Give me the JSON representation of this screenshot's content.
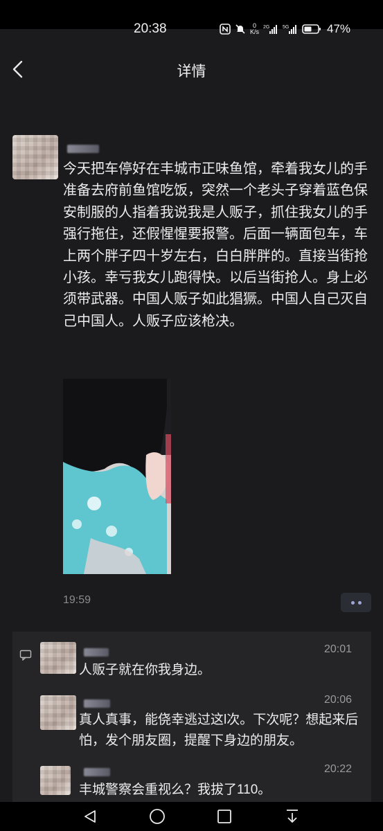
{
  "status_bar": {
    "time": "20:38",
    "network_speed": "0\nK/s",
    "signal_1_label": "2G",
    "signal_2_label": "5G",
    "battery_percent": "47%"
  },
  "header": {
    "title": "详情"
  },
  "post": {
    "text": "今天把车停好在丰城市正味鱼馆，牵着我女儿的手准备去府前鱼馆吃饭，突然一个老头子穿着蓝色保安制服的人指着我说我是人贩子，抓住我女儿的手强行拖住，还假惺惺要报警。后面一辆面包车，车上两个胖子四十岁左右，白白胖胖的。直接当街抢小孩。幸亏我女儿跑得快。以后当街抢人。身上必须带武器。中国人贩子如此猖獗。中国人自己灭自己中国人。人贩子应该枪决。",
    "time": "19:59"
  },
  "comments": [
    {
      "time": "20:01",
      "text": "人贩子就在你我身边。"
    },
    {
      "time": "20:06",
      "text": "真人真事，能侥幸逃过这l次。下次呢？想起来后怕，发个朋友圈，提醒下身边的朋友。"
    },
    {
      "time": "20:22",
      "text": "丰城警察会重视么？我拔了110。"
    }
  ],
  "icons": {
    "back": "chevron-left-icon",
    "more": "more-dots-icon",
    "comment": "comment-bubble-icon",
    "nav_back": "triangle-back-icon",
    "nav_home": "circle-home-icon",
    "nav_recents": "square-recents-icon",
    "nav_notifications": "pull-down-icon"
  },
  "colors": {
    "background": "#1b1b1d",
    "comment_panel": "#252527",
    "more_dots": "#9ea6d8"
  }
}
